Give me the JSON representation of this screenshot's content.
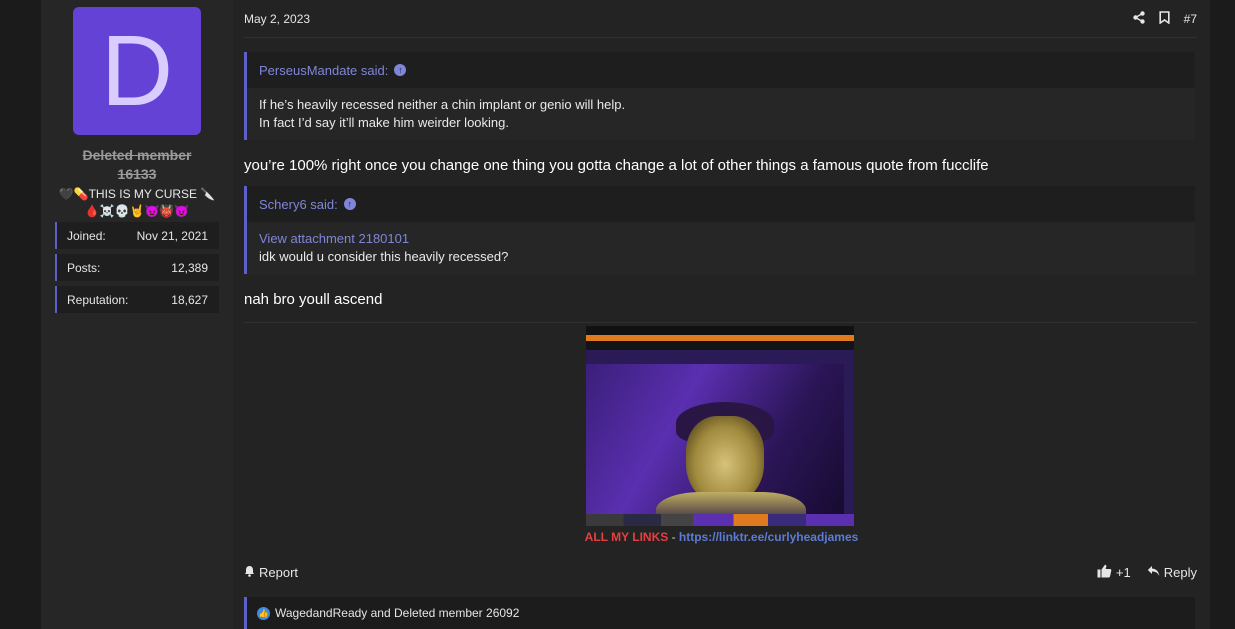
{
  "post": {
    "date": "May 2, 2023",
    "post_number": "#7",
    "share_icon": "share-icon",
    "bookmark_icon": "bookmark-icon"
  },
  "user": {
    "avatar_letter": "D",
    "avatar_color": "#6442d6",
    "name_line1": "Deleted member",
    "name_line2": "16133",
    "title_line1": "🖤💊THIS IS MY CURSE 🔪",
    "title_line2": "🩸☠️💀🤘👿👹😈",
    "stats": [
      {
        "label": "Joined:",
        "value": "Nov 21, 2021"
      },
      {
        "label": "Posts:",
        "value": "12,389"
      },
      {
        "label": "Reputation:",
        "value": "18,627"
      }
    ]
  },
  "quote1": {
    "author": "PerseusMandate said:",
    "line1": "If he’s heavily recessed neither a chin implant or genio will help.",
    "line2": "In fact I’d say it’ll make him weirder looking."
  },
  "reply1": "you’re 100% right once you change one thing you gotta change a lot of other things a famous quote from fucclife",
  "quote2": {
    "author": "Schery6 said:",
    "attachment_link": "View attachment 2180101",
    "line1": "idk would u consider this heavily recessed?"
  },
  "reply2": "nah bro youll ascend",
  "signature": {
    "red_text": "ALL MY LINKS",
    "separator": " - ",
    "link": "https://linktr.ee/curlyheadjames"
  },
  "actions": {
    "report": "Report",
    "like_count": "+1",
    "reply": "Reply"
  },
  "reactions": {
    "text": "WagedandReady and Deleted member 26092"
  },
  "colors": {
    "accent": "#5c60c9",
    "link": "#7f86d9",
    "signature_red": "#e44040"
  }
}
